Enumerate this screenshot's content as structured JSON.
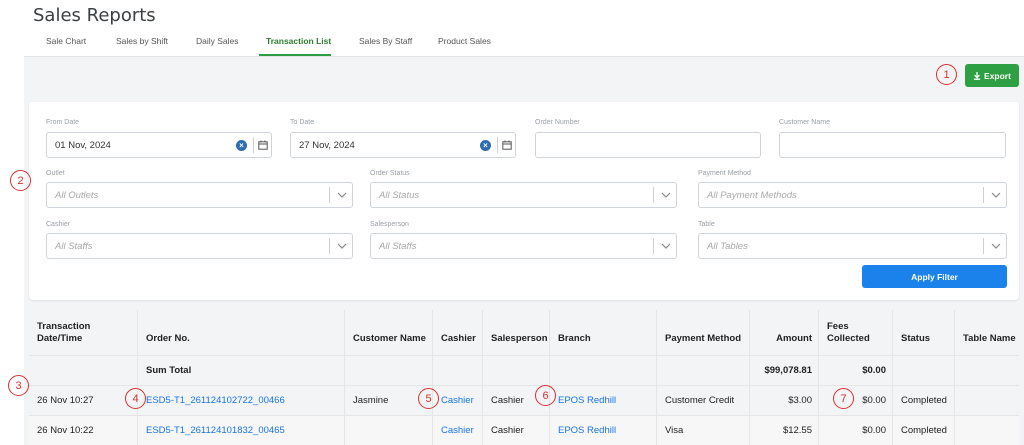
{
  "header": {
    "title": "Sales Reports",
    "tabs": [
      {
        "label": "Sale Chart"
      },
      {
        "label": "Sales by Shift"
      },
      {
        "label": "Daily Sales"
      },
      {
        "label": "Transaction List",
        "active": true
      },
      {
        "label": "Sales By Staff"
      },
      {
        "label": "Product Sales"
      }
    ]
  },
  "toolbar": {
    "export_label": "Export",
    "export_icon": "download-icon"
  },
  "filters": {
    "from_date": {
      "label": "From Date",
      "value": "01 Nov, 2024"
    },
    "to_date": {
      "label": "To Date",
      "value": "27 Nov, 2024"
    },
    "order_number": {
      "label": "Order Number",
      "value": ""
    },
    "customer_name": {
      "label": "Customer Name",
      "value": ""
    },
    "outlet": {
      "label": "Outlet",
      "placeholder": "All Outlets"
    },
    "order_status": {
      "label": "Order Status",
      "placeholder": "All Status"
    },
    "payment_method": {
      "label": "Payment Method",
      "placeholder": "All Payment Methods"
    },
    "cashier": {
      "label": "Cashier",
      "placeholder": "All Staffs"
    },
    "salesperson": {
      "label": "Salesperson",
      "placeholder": "All Staffs"
    },
    "table": {
      "label": "Table",
      "placeholder": "All Tables"
    },
    "apply_label": "Apply Filter"
  },
  "table": {
    "headers": {
      "datetime": "Transaction Date/Time",
      "order_no": "Order No.",
      "customer_name": "Customer Name",
      "cashier": "Cashier",
      "salesperson": "Salesperson",
      "branch": "Branch",
      "payment_method": "Payment Method",
      "amount": "Amount",
      "fees": "Fees Collected",
      "status": "Status",
      "table_name": "Table Name"
    },
    "sum_row": {
      "label": "Sum Total",
      "amount": "$99,078.81",
      "fees": "$0.00"
    },
    "rows": [
      {
        "datetime": "26 Nov 10:27",
        "order_no": "ESD5-T1_261124102722_00466",
        "customer_name": "Jasmine",
        "cashier": "Cashier",
        "salesperson": "Cashier",
        "branch": "EPOS Redhill",
        "payment_method": "Customer Credit",
        "amount": "$3.00",
        "fees": "$0.00",
        "status": "Completed",
        "table_name": ""
      },
      {
        "datetime": "26 Nov 10:22",
        "order_no": "ESD5-T1_261124101832_00465",
        "customer_name": "",
        "cashier": "Cashier",
        "salesperson": "Cashier",
        "branch": "EPOS Redhill",
        "payment_method": "Visa",
        "amount": "$12.55",
        "fees": "$0.00",
        "status": "Completed",
        "table_name": ""
      }
    ]
  },
  "annotations": [
    "1",
    "2",
    "3",
    "4",
    "5",
    "6",
    "7"
  ],
  "colors": {
    "accent_green": "#2ea043",
    "primary_blue": "#1a82ea",
    "link_blue": "#1a73e8",
    "marker_red": "#d93030"
  }
}
